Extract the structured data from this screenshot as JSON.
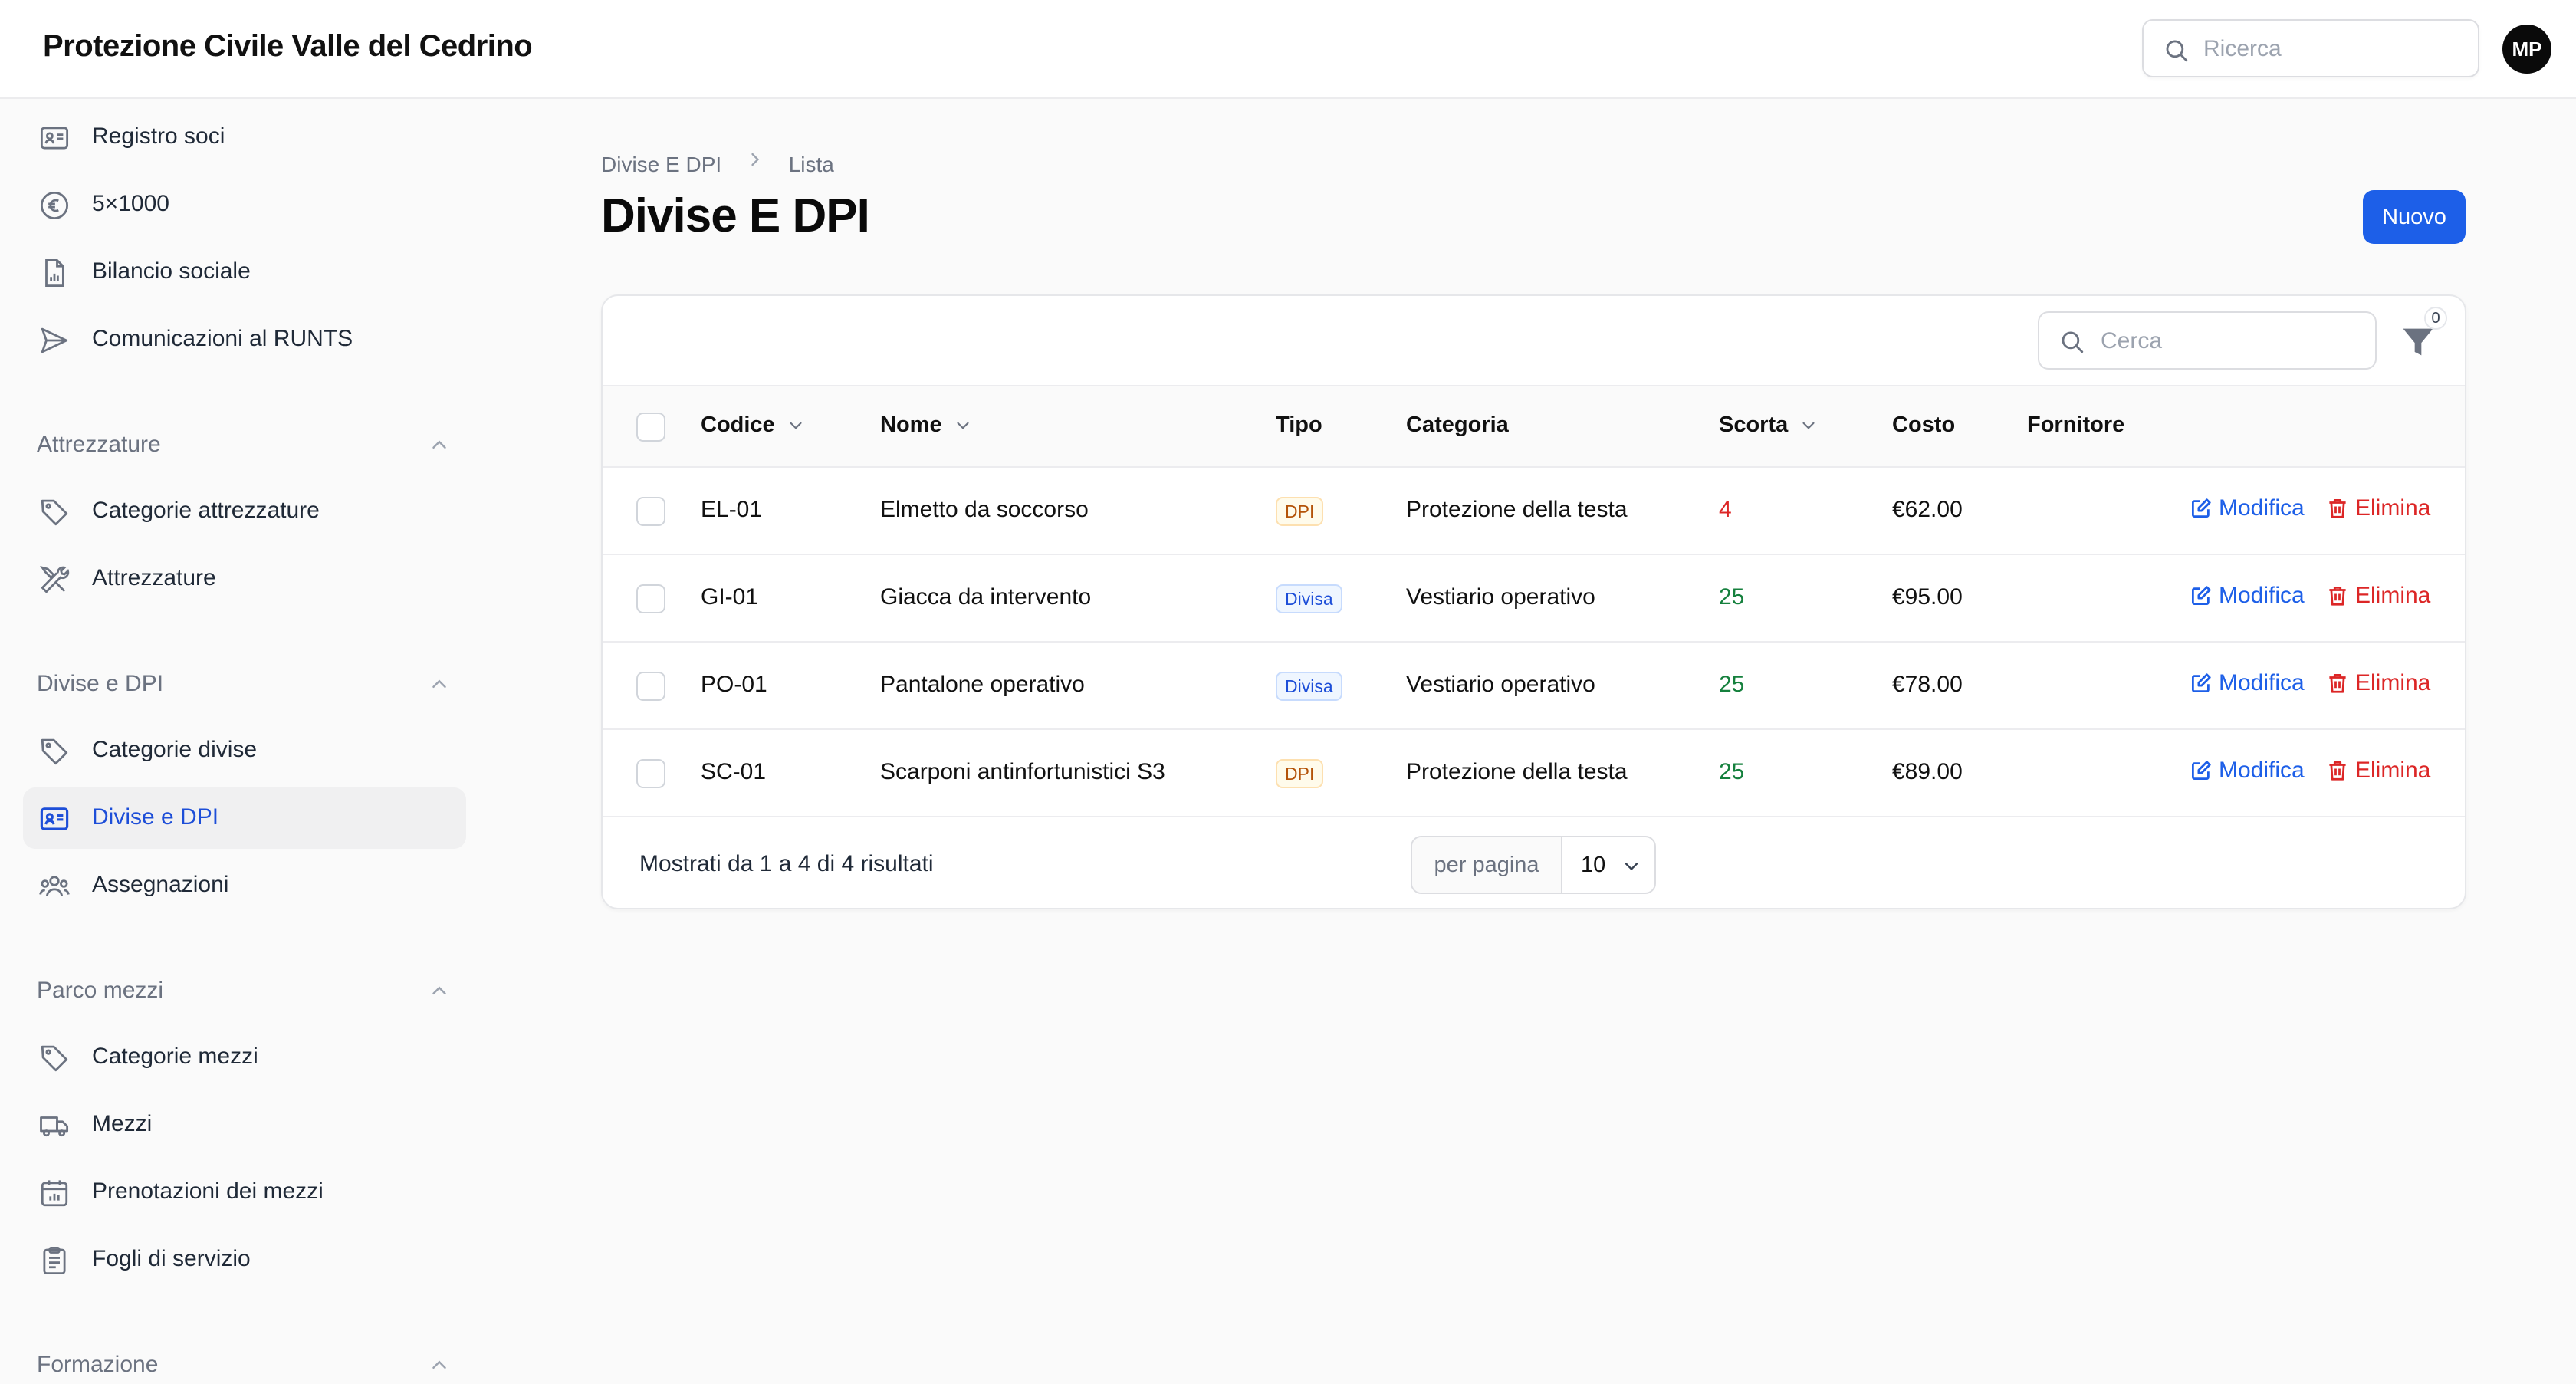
{
  "app": {
    "title": "Protezione Civile Valle del Cedrino"
  },
  "header": {
    "search_placeholder": "Ricerca",
    "avatar_initials": "MP"
  },
  "sidebar": {
    "items_top": [
      {
        "label": "Registro soci",
        "icon": "id-card-icon"
      },
      {
        "label": "5×1000",
        "icon": "euro-icon"
      },
      {
        "label": "Bilancio sociale",
        "icon": "document-chart-icon"
      },
      {
        "label": "Comunicazioni al RUNTS",
        "icon": "paper-plane-icon"
      }
    ],
    "groups": [
      {
        "label": "Attrezzature",
        "items": [
          {
            "label": "Categorie attrezzature",
            "icon": "tag-icon"
          },
          {
            "label": "Attrezzature",
            "icon": "wrench-screwdriver-icon"
          }
        ]
      },
      {
        "label": "Divise e DPI",
        "items": [
          {
            "label": "Categorie divise",
            "icon": "tag-icon"
          },
          {
            "label": "Divise e DPI",
            "icon": "id-card-icon",
            "active": true
          },
          {
            "label": "Assegnazioni",
            "icon": "users-icon"
          }
        ]
      },
      {
        "label": "Parco mezzi",
        "items": [
          {
            "label": "Categorie mezzi",
            "icon": "tag-icon"
          },
          {
            "label": "Mezzi",
            "icon": "truck-icon"
          },
          {
            "label": "Prenotazioni dei mezzi",
            "icon": "calendar-icon"
          },
          {
            "label": "Fogli di servizio",
            "icon": "clipboard-icon"
          }
        ]
      },
      {
        "label": "Formazione",
        "items": []
      }
    ]
  },
  "breadcrumb": {
    "parent": "Divise E DPI",
    "current": "Lista"
  },
  "page": {
    "title": "Divise E DPI",
    "new_button": "Nuovo"
  },
  "table": {
    "search_placeholder": "Cerca",
    "filter_count": "0",
    "columns": {
      "code": "Codice",
      "name": "Nome",
      "type": "Tipo",
      "category": "Categoria",
      "stock": "Scorta",
      "cost": "Costo",
      "supplier": "Fornitore"
    },
    "rows": [
      {
        "code": "EL-01",
        "name": "Elmetto da soccorso",
        "type": "DPI",
        "category": "Protezione della testa",
        "stock": "4",
        "stock_status": "low",
        "cost": "€62.00",
        "supplier": ""
      },
      {
        "code": "GI-01",
        "name": "Giacca da intervento",
        "type": "Divisa",
        "category": "Vestiario operativo",
        "stock": "25",
        "stock_status": "ok",
        "cost": "€95.00",
        "supplier": ""
      },
      {
        "code": "PO-01",
        "name": "Pantalone operativo",
        "type": "Divisa",
        "category": "Vestiario operativo",
        "stock": "25",
        "stock_status": "ok",
        "cost": "€78.00",
        "supplier": ""
      },
      {
        "code": "SC-01",
        "name": "Scarponi antinfortunistici S3",
        "type": "DPI",
        "category": "Protezione della testa",
        "stock": "25",
        "stock_status": "ok",
        "cost": "€89.00",
        "supplier": ""
      }
    ],
    "actions": {
      "edit": "Modifica",
      "delete": "Elimina"
    },
    "footer": {
      "results": "Mostrati da 1 a 4 di 4 risultati",
      "per_page_label": "per pagina",
      "per_page_value": "10"
    }
  },
  "colors": {
    "accent": "#1d5fe8",
    "danger": "#dc2626",
    "success": "#15803d",
    "warning": "#b45309"
  }
}
